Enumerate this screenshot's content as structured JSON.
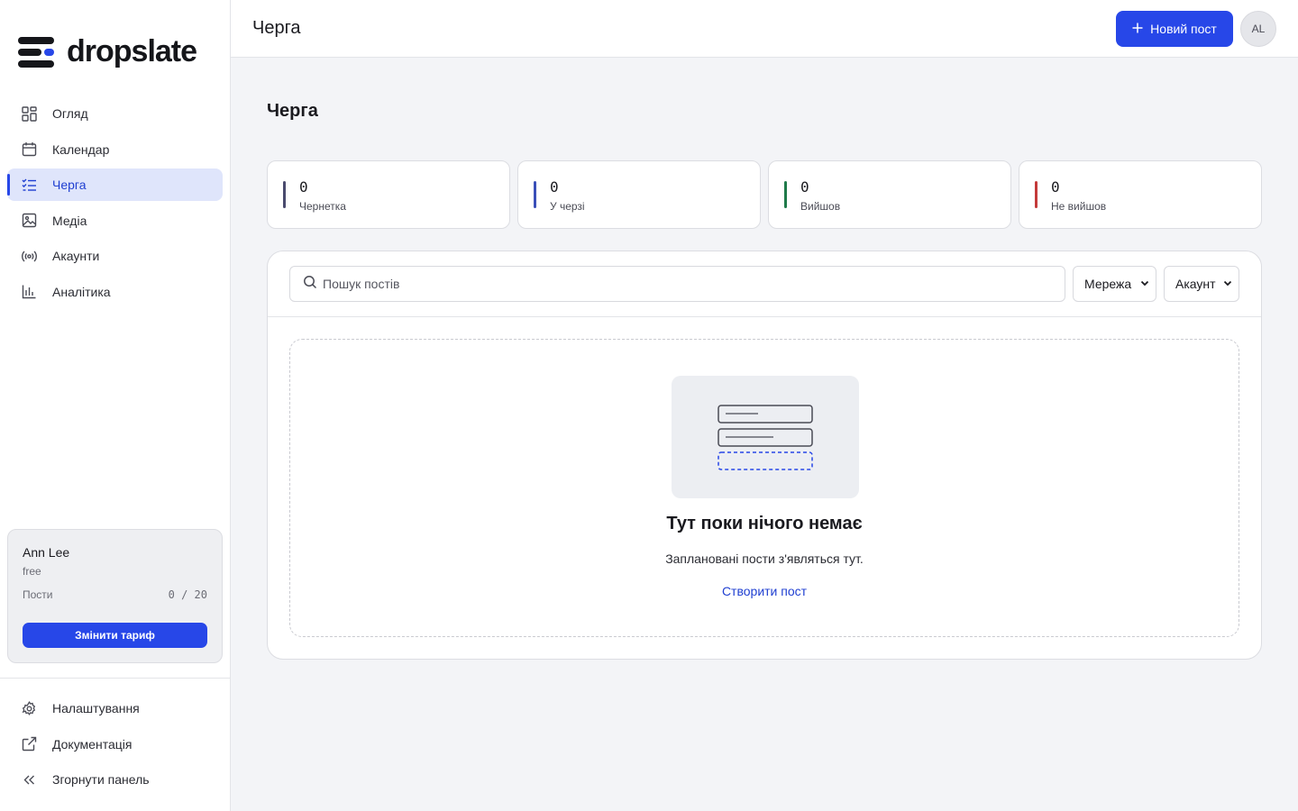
{
  "app": {
    "brand": "dropslate"
  },
  "sidebar": {
    "items": [
      {
        "label": "Огляд",
        "icon": "grid-icon"
      },
      {
        "label": "Календар",
        "icon": "calendar-icon"
      },
      {
        "label": "Черга",
        "icon": "list-check-icon",
        "active": true
      },
      {
        "label": "Медіа",
        "icon": "image-icon"
      },
      {
        "label": "Акаунти",
        "icon": "broadcast-icon"
      },
      {
        "label": "Аналітика",
        "icon": "bar-chart-icon"
      }
    ],
    "plan": {
      "name": "Ann Lee",
      "tier": "free",
      "posts_label": "Пости",
      "posts_count": "0 / 20",
      "upgrade_label": "Змінити тариф"
    },
    "bottom_items": [
      {
        "label": "Налаштування",
        "icon": "gear-icon"
      },
      {
        "label": "Документація",
        "icon": "external-link-icon"
      },
      {
        "label": "Згорнути панель",
        "icon": "chevrons-left-icon"
      }
    ]
  },
  "header": {
    "title": "Черга",
    "new_post_label": "Новий пост",
    "avatar_initials": "AL"
  },
  "main": {
    "title": "Черга",
    "stats": [
      {
        "value": "0",
        "label": "Чернетка",
        "color": "#4a4b6e"
      },
      {
        "value": "0",
        "label": "У черзі",
        "color": "#3a4fb8"
      },
      {
        "value": "0",
        "label": "Вийшов",
        "color": "#1f7a4a"
      },
      {
        "value": "0",
        "label": "Не вийшов",
        "color": "#c43a3a"
      }
    ],
    "search_placeholder": "Пошук постів",
    "filters": {
      "network": "Мережа",
      "account": "Акаунт"
    },
    "empty": {
      "title": "Тут поки нічого немає",
      "subtitle": "Заплановані пости з'являться тут.",
      "cta": "Створити пост"
    }
  },
  "colors": {
    "accent": "#2747e8",
    "active_bg": "#dfe5fb"
  }
}
